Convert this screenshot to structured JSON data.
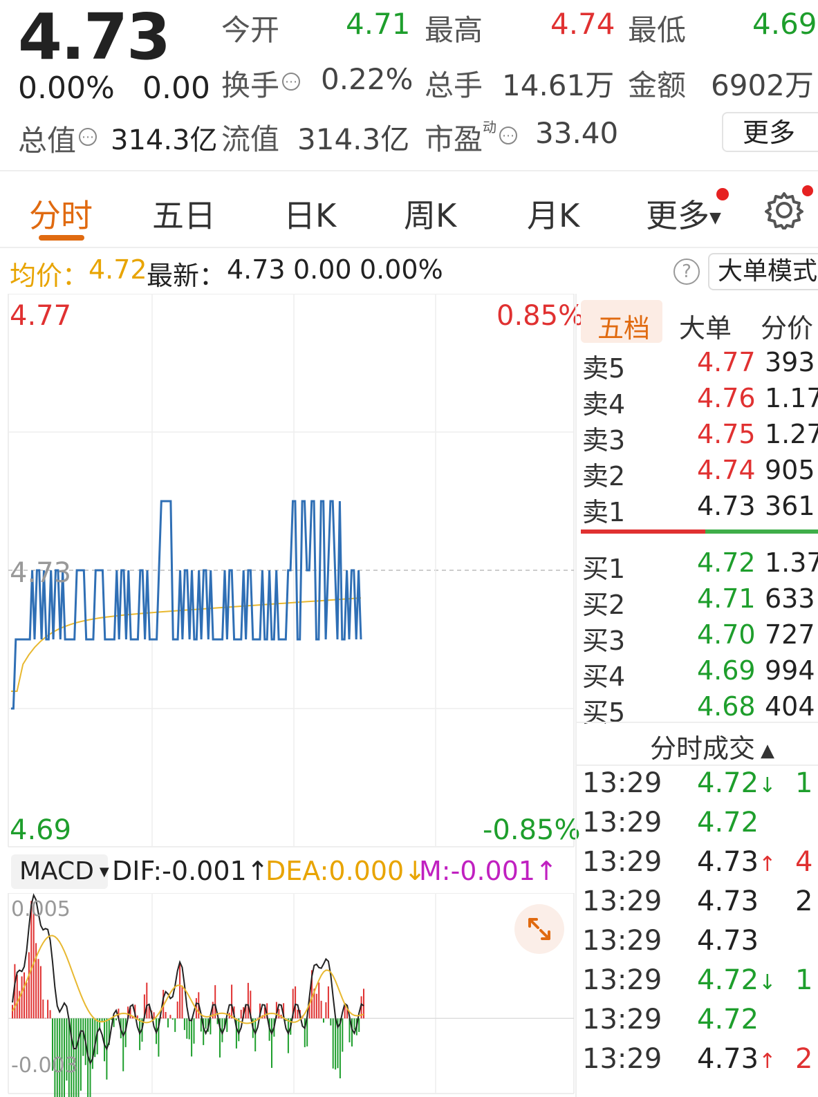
{
  "quote": {
    "price": "4.73",
    "change_pct": "0.00%",
    "change": "0.00",
    "total_value_label": "总值",
    "total_value": "314.3亿",
    "open_label": "今开",
    "open": "4.71",
    "high_label": "最高",
    "high": "4.74",
    "low_label": "最低",
    "low": "4.69",
    "turnover_label": "换手",
    "turnover": "0.22%",
    "volume_label": "总手",
    "volume": "14.61万",
    "amount_label": "金额",
    "amount": "6902万",
    "float_value_label": "流值",
    "float_value": "314.3亿",
    "pe_label": "市盈",
    "pe_sup": "动",
    "pe": "33.40",
    "more_label": "更多"
  },
  "tabs": [
    "分时",
    "五日",
    "日K",
    "周K",
    "月K",
    "更多"
  ],
  "info_bar": {
    "avg_label": "均价：",
    "avg": "4.72",
    "latest_label": "最新：",
    "latest": "4.73",
    "change": "0.00",
    "change_pct": "0.00%",
    "mode_label": "大单模式"
  },
  "price_axis": {
    "max": "4.77",
    "min": "4.69",
    "ref": "4.73",
    "max_pct": "0.85%",
    "min_pct": "-0.85%"
  },
  "macd": {
    "select": "MACD",
    "dif": "DIF:-0.001",
    "dea": "DEA:0.000",
    "m": "M:-0.001",
    "max": "0.005",
    "min": "-0.003"
  },
  "orderbook": {
    "tabs": [
      "五档",
      "大单",
      "分价"
    ],
    "sells": [
      {
        "label": "卖5",
        "price": "4.77",
        "vol": "393"
      },
      {
        "label": "卖4",
        "price": "4.76",
        "vol": "1.17"
      },
      {
        "label": "卖3",
        "price": "4.75",
        "vol": "1.27"
      },
      {
        "label": "卖2",
        "price": "4.74",
        "vol": "905"
      },
      {
        "label": "卖1",
        "price": "4.73",
        "vol": "361"
      }
    ],
    "buys": [
      {
        "label": "买1",
        "price": "4.72",
        "vol": "1.37"
      },
      {
        "label": "买2",
        "price": "4.71",
        "vol": "633"
      },
      {
        "label": "买3",
        "price": "4.70",
        "vol": "727"
      },
      {
        "label": "买4",
        "price": "4.69",
        "vol": "994"
      },
      {
        "label": "买5",
        "price": "4.68",
        "vol": "404"
      }
    ]
  },
  "trades": {
    "header": "分时成交",
    "rows": [
      {
        "time": "13:29",
        "price": "4.72",
        "dir": "↓",
        "vol": "1"
      },
      {
        "time": "13:29",
        "price": "4.72",
        "dir": "",
        "vol": ""
      },
      {
        "time": "13:29",
        "price": "4.73",
        "dir": "↑",
        "vol": "4"
      },
      {
        "time": "13:29",
        "price": "4.73",
        "dir": "",
        "vol": "2"
      },
      {
        "time": "13:29",
        "price": "4.73",
        "dir": "",
        "vol": ""
      },
      {
        "time": "13:29",
        "price": "4.72",
        "dir": "↓",
        "vol": "1"
      },
      {
        "time": "13:29",
        "price": "4.72",
        "dir": "",
        "vol": ""
      },
      {
        "time": "13:29",
        "price": "4.73",
        "dir": "↑",
        "vol": "2"
      }
    ]
  },
  "colors": {
    "up": "#e03131",
    "down": "#1e9e2c",
    "avg": "#e8a400",
    "price_line": "#2f6fb5",
    "accent": "#e06a10"
  }
}
